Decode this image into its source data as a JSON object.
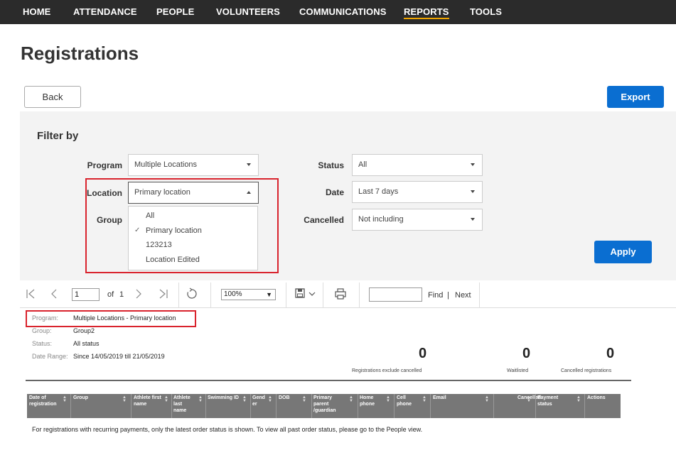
{
  "nav": {
    "items": [
      "HOME",
      "ATTENDANCE",
      "PEOPLE",
      "VOLUNTEERS",
      "COMMUNICATIONS",
      "REPORTS",
      "TOOLS"
    ],
    "active": "REPORTS"
  },
  "page": {
    "title": "Registrations"
  },
  "buttons": {
    "back": "Back",
    "export": "Export",
    "apply": "Apply"
  },
  "filter": {
    "title": "Filter by",
    "program_label": "Program",
    "program_value": "Multiple Locations",
    "location_label": "Location",
    "location_value": "Primary location",
    "group_label": "Group",
    "status_label": "Status",
    "status_value": "All",
    "date_label": "Date",
    "date_value": "Last 7 days",
    "cancelled_label": "Cancelled",
    "cancelled_value": "Not including",
    "location_options": [
      "All",
      "Primary location",
      "123213",
      "Location Edited"
    ],
    "location_selected": "Primary location"
  },
  "toolbar": {
    "page": "1",
    "of_label": "of",
    "total_pages": "1",
    "zoom": "100%",
    "find_label": "Find",
    "separator": "|",
    "next_label": "Next"
  },
  "report": {
    "program_label": "Program:",
    "program_value": "Multiple Locations - Primary location",
    "group_label": "Group:",
    "group_value": "Group2",
    "status_label": "Status:",
    "status_value": "All status",
    "date_label": "Date Range:",
    "date_value": "Since 14/05/2019 till 21/05/2019",
    "stats": [
      {
        "value": "0",
        "label": "Registrations exclude cancelled"
      },
      {
        "value": "0",
        "label": "Waitlisted"
      },
      {
        "value": "0",
        "label": "Cancelled registrations"
      }
    ],
    "columns": [
      "Date of registration",
      "Group",
      "Athlete first name",
      "Athlete last name",
      "Swimming ID",
      "Gend er",
      "DOB",
      "Primary parent /guardian",
      "Home phone",
      "Cell phone",
      "Email",
      "Cancelled",
      "Payment status",
      "Actions"
    ],
    "footnote": "For registrations with recurring payments, only the latest order status is shown. To view all past order status, please go to the People view."
  },
  "colors": {
    "nav_bg": "#2b2b2b",
    "accent": "#0a6ed1",
    "highlight": "#d9232d",
    "active_underline": "#f0a500"
  }
}
